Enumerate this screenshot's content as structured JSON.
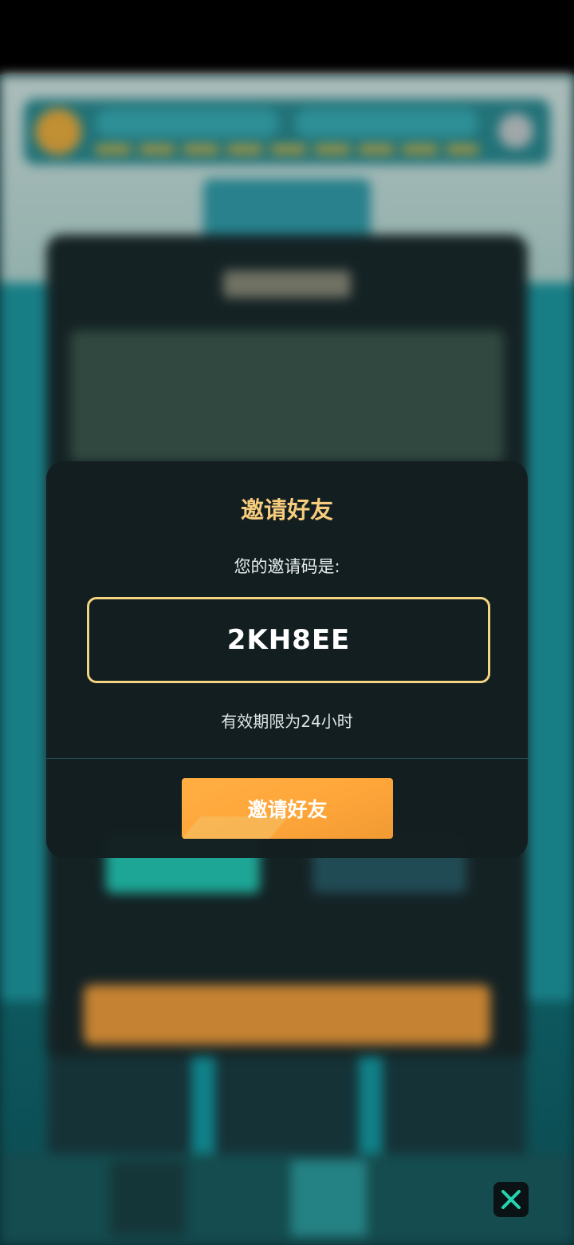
{
  "modal": {
    "title": "邀请好友",
    "code_label": "您的邀请码是:",
    "invite_code": "2KH8EE",
    "expiry_note": "有效期限为24小时",
    "invite_button_label": "邀请好友"
  },
  "overlay": {
    "close_icon": "close-icon"
  },
  "colors": {
    "title_gold": "#f7cc7c",
    "code_border": "#f3d481",
    "button_orange": "#ffa63a",
    "modal_bg": "#141e20"
  }
}
